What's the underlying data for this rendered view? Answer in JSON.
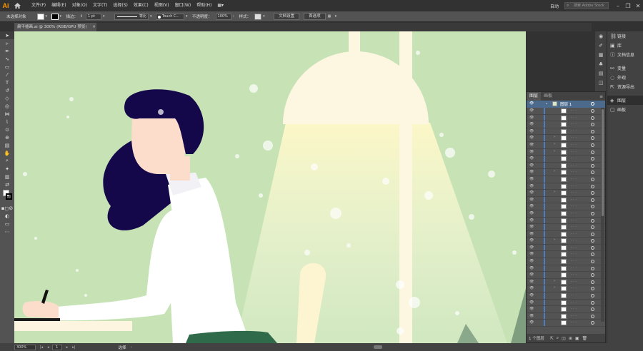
{
  "app": {
    "logo": "Ai"
  },
  "menu": {
    "items": [
      "文件(F)",
      "编辑(E)",
      "对象(O)",
      "文字(T)",
      "选择(S)",
      "效果(C)",
      "视图(V)",
      "窗口(W)",
      "帮助(H)"
    ],
    "arrange_label": "▦▾",
    "workspace": "自动",
    "search_placeholder": "搜索 Adobe Stock"
  },
  "control": {
    "selection_status": "未选择对象",
    "stroke_label": "描边：",
    "stroke_weight": "1 pt",
    "stroke_style": "等比",
    "brush": "Touch C...",
    "opacity_label": "不透明度：",
    "opacity_value": "100%",
    "style_label": "样式：",
    "doc_setup": "文档设置",
    "prefs": "首选项"
  },
  "document": {
    "tab_title": "扁平插画.ai @ 300% (RGB/GPU 预览)"
  },
  "right_panels": {
    "items": [
      "链接",
      "库",
      "文档信息",
      "变量",
      "外观",
      "资源导出",
      "图层",
      "画板"
    ]
  },
  "layers": {
    "tabs": [
      "图层",
      "画板"
    ],
    "root_name": "图层 1",
    "footer": "1 个图层",
    "row_count": 32
  },
  "status": {
    "zoom": "300%",
    "page": "1",
    "tool": "选择"
  },
  "colors": {
    "canvas_bg": "#c7e3b6",
    "hair": "#15084a",
    "skin": "#fcdccb",
    "shirt": "#ffffff",
    "lamp": "#fdf6e1",
    "accent": "#ff9a00"
  }
}
